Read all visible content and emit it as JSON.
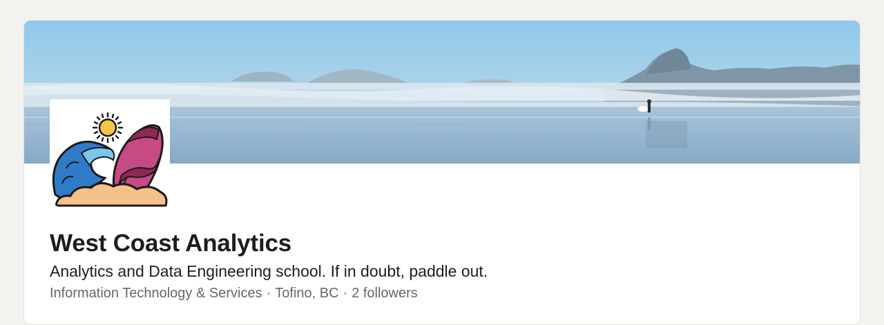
{
  "company": {
    "name": "West Coast Analytics",
    "tagline": "Analytics and Data Engineering school. If in doubt, paddle out.",
    "industry": "Information Technology & Services",
    "location": "Tofino, BC",
    "followers": "2 followers",
    "separator": "·"
  },
  "icons": {
    "logo": "wave-sun-surfboard-logo",
    "cover": "beach-cover-photo"
  }
}
